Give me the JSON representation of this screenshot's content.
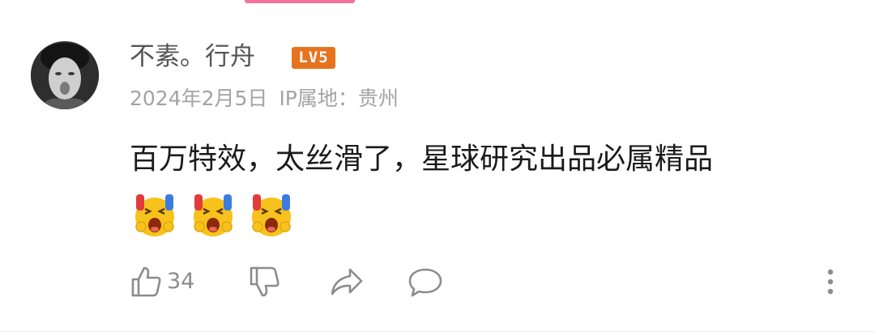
{
  "comment": {
    "username": "不素。行舟",
    "level_badge": "LV5",
    "date": "2024年2月5日",
    "ip_location": "IP属地：贵州",
    "text": "百万特效，太丝滑了，星球研究出品必属精品",
    "emojis": [
      "laughing-cry-emoji",
      "laughing-cry-emoji",
      "laughing-cry-emoji"
    ]
  },
  "actions": {
    "like_count": "34",
    "icons": [
      "thumb-up-icon",
      "thumb-down-icon",
      "share-icon",
      "reply-icon",
      "more-icon"
    ]
  },
  "colors": {
    "accent_bar": "#f2729a",
    "level_badge": "#e8731f",
    "username": "#555555",
    "meta": "#a3a3a3",
    "text": "#1b1b1b",
    "icon": "#8c8c8c"
  }
}
